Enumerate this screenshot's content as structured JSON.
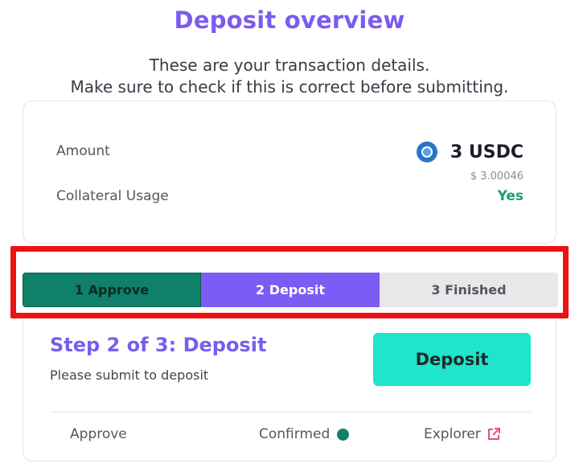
{
  "page": {
    "title": "Deposit overview",
    "subtitle_line1": "These are your transaction details.",
    "subtitle_line2": "Make sure to check if this is correct before submitting."
  },
  "details": {
    "amount_label": "Amount",
    "amount_value": "3 USDC",
    "amount_usd": "$ 3.00046",
    "asset_icon": "usdc-icon",
    "collateral_label": "Collateral Usage",
    "collateral_value": "Yes"
  },
  "steps": [
    {
      "label": "1 Approve",
      "state": "completed"
    },
    {
      "label": "2 Deposit",
      "state": "active"
    },
    {
      "label": "3 Finished",
      "state": "pending"
    }
  ],
  "current_step": {
    "title": "Step 2 of 3: Deposit",
    "description": "Please submit to deposit",
    "button_label": "Deposit"
  },
  "status": {
    "action_label": "Approve",
    "state_label": "Confirmed",
    "link_label": "Explorer"
  },
  "colors": {
    "accent": "#7b5cf5",
    "success": "#0f8069",
    "button": "#1fe5cc",
    "highlight": "#ee1111"
  }
}
